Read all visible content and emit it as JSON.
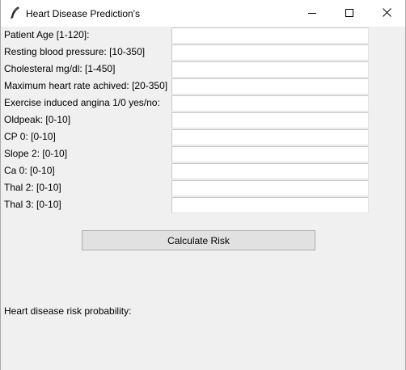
{
  "window": {
    "title": "Heart Disease Prediction's",
    "icon": "feather-icon",
    "controls": [
      "minimize-icon",
      "maximize-icon",
      "close-icon"
    ]
  },
  "form": {
    "fields": [
      {
        "label": "Patient Age [1-120]:",
        "value": ""
      },
      {
        "label": "Resting blood pressure: [10-350]",
        "value": ""
      },
      {
        "label": "Cholesteral mg/dl: [1-450]",
        "value": ""
      },
      {
        "label": "Maximum heart rate achived: [20-350]",
        "value": ""
      },
      {
        "label": "Exercise induced angina 1/0 yes/no:",
        "value": ""
      },
      {
        "label": "Oldpeak: [0-10]",
        "value": ""
      },
      {
        "label": "CP 0: [0-10]",
        "value": ""
      },
      {
        "label": "Slope 2: [0-10]",
        "value": ""
      },
      {
        "label": "Ca 0: [0-10]",
        "value": ""
      },
      {
        "label": "Thal 2: [0-10]",
        "value": ""
      },
      {
        "label": "Thal 3: [0-10]",
        "value": ""
      }
    ]
  },
  "actions": {
    "calculate_label": "Calculate Risk"
  },
  "result": {
    "label": "Heart disease risk probability:",
    "value": ""
  },
  "colors": {
    "window_bg": "#f0f0f0",
    "titlebar_bg": "#ffffff",
    "button_bg": "#e1e1e1",
    "button_border": "#adadad"
  }
}
